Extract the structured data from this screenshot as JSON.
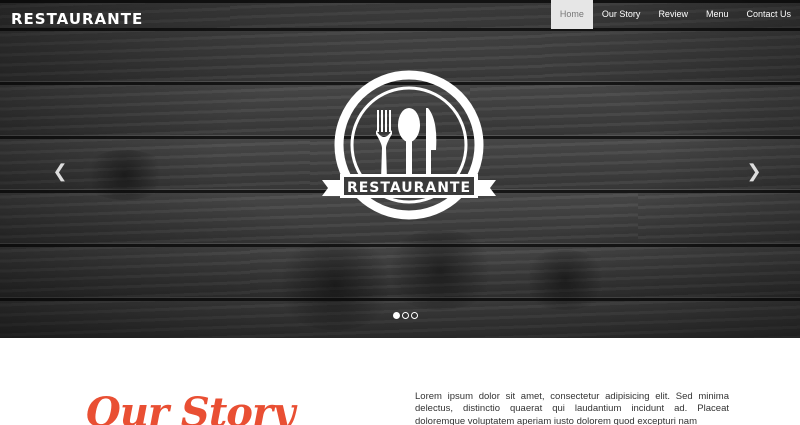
{
  "brand": {
    "name": "RESTAURANTE"
  },
  "nav": {
    "items": [
      {
        "label": "Home",
        "active": true
      },
      {
        "label": "Our Story",
        "active": false
      },
      {
        "label": "Review",
        "active": false
      },
      {
        "label": "Menu",
        "active": false
      },
      {
        "label": "Contact Us",
        "active": false
      }
    ]
  },
  "hero": {
    "logo_text": "RESTAURANTE",
    "prev_icon": "chevron-left-icon",
    "next_icon": "chevron-right-icon",
    "slides": {
      "count": 3,
      "active_index": 0
    }
  },
  "story": {
    "title": "Our Story",
    "text": "Lorem ipsum dolor sit amet, consectetur adipisicing elit. Sed minima delectus, distinctio quaerat qui laudantium incidunt ad. Placeat doloremque voluptatem aperiam iusto dolorem quod excepturi nam"
  },
  "colors": {
    "accent": "#e94f33",
    "nav_active_bg": "#e6e6e6"
  }
}
